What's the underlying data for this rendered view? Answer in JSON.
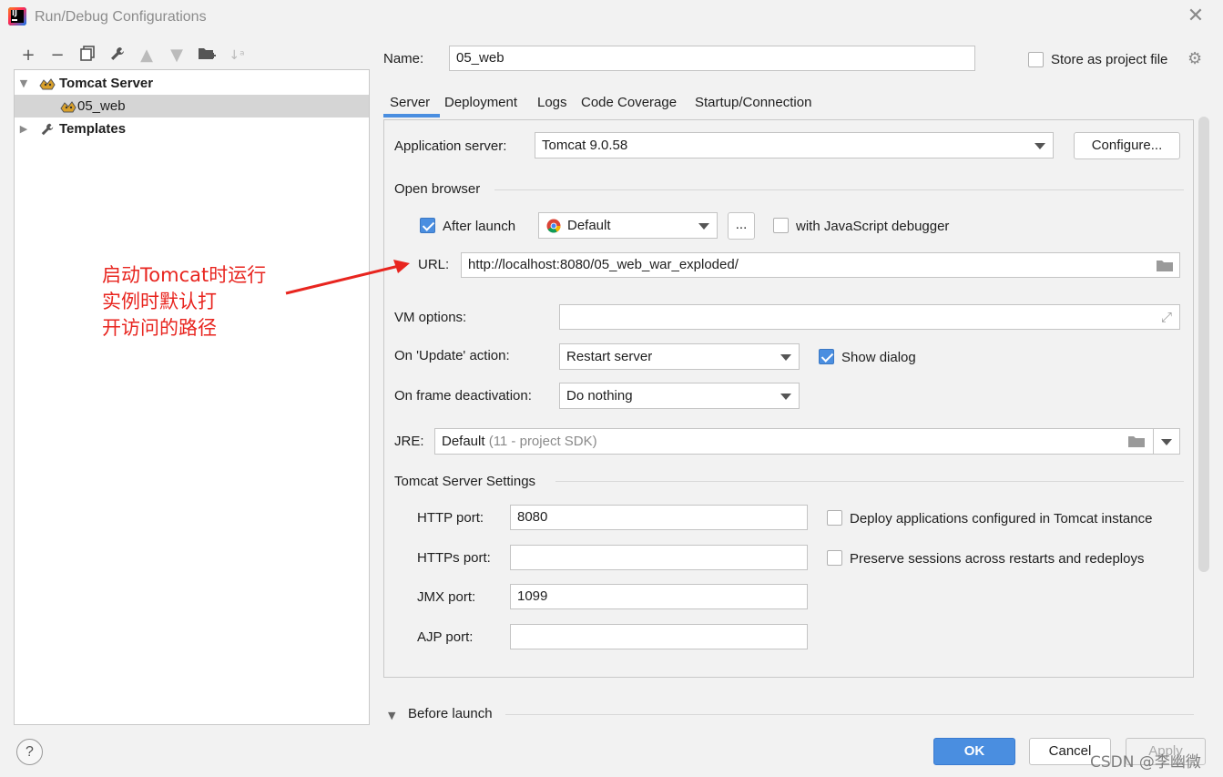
{
  "window": {
    "title": "Run/Debug Configurations",
    "close_icon": "close-icon"
  },
  "toolbar": {
    "icons": [
      "add-icon",
      "remove-icon",
      "copy-icon",
      "wrench-icon",
      "move-up-icon",
      "move-down-icon",
      "folder-add-icon",
      "sort-icon"
    ]
  },
  "tree": {
    "group_label": "Tomcat Server",
    "config_label": "05_web",
    "templates_label": "Templates"
  },
  "form": {
    "name_label": "Name:",
    "name_value": "05_web",
    "store_as_project_file": "Store as project file",
    "tabs": [
      "Server",
      "Deployment",
      "Logs",
      "Code Coverage",
      "Startup/Connection"
    ],
    "active_tab": "Server",
    "application_server_label": "Application server:",
    "application_server_value": "Tomcat 9.0.58",
    "configure_button": "Configure...",
    "open_browser_section": "Open browser",
    "after_launch_label": "After launch",
    "after_launch_checked": true,
    "browser_value": "Default",
    "ellipsis_button": "...",
    "js_debugger_label": "with JavaScript debugger",
    "url_label": "URL:",
    "url_value": "http://localhost:8080/05_web_war_exploded/",
    "vm_options_label": "VM options:",
    "vm_options_value": "",
    "on_update_label": "On 'Update' action:",
    "on_update_value": "Restart server",
    "show_dialog_label": "Show dialog",
    "show_dialog_checked": true,
    "on_frame_label": "On frame deactivation:",
    "on_frame_value": "Do nothing",
    "jre_label": "JRE:",
    "jre_value": "Default",
    "jre_hint": "(11 - project SDK)",
    "tomcat_settings_section": "Tomcat Server Settings",
    "http_port_label": "HTTP port:",
    "http_port_value": "8080",
    "https_port_label": "HTTPs port:",
    "https_port_value": "",
    "jmx_port_label": "JMX port:",
    "jmx_port_value": "1099",
    "ajp_port_label": "AJP port:",
    "ajp_port_value": "",
    "deploy_apps_label": "Deploy applications configured in Tomcat instance",
    "preserve_sessions_label": "Preserve sessions across restarts and redeploys",
    "before_launch_label": "Before launch"
  },
  "annotation": {
    "lines": [
      "启动Tomcat时运行",
      "实例时默认打",
      "开访问的路径"
    ],
    "color": "#e8251f"
  },
  "footer": {
    "help": "?",
    "ok": "OK",
    "cancel": "Cancel",
    "apply": "Apply",
    "watermark": "CSDN @李幽微"
  },
  "colors": {
    "accent": "#4a8ee0",
    "annotation": "#e8251f"
  }
}
